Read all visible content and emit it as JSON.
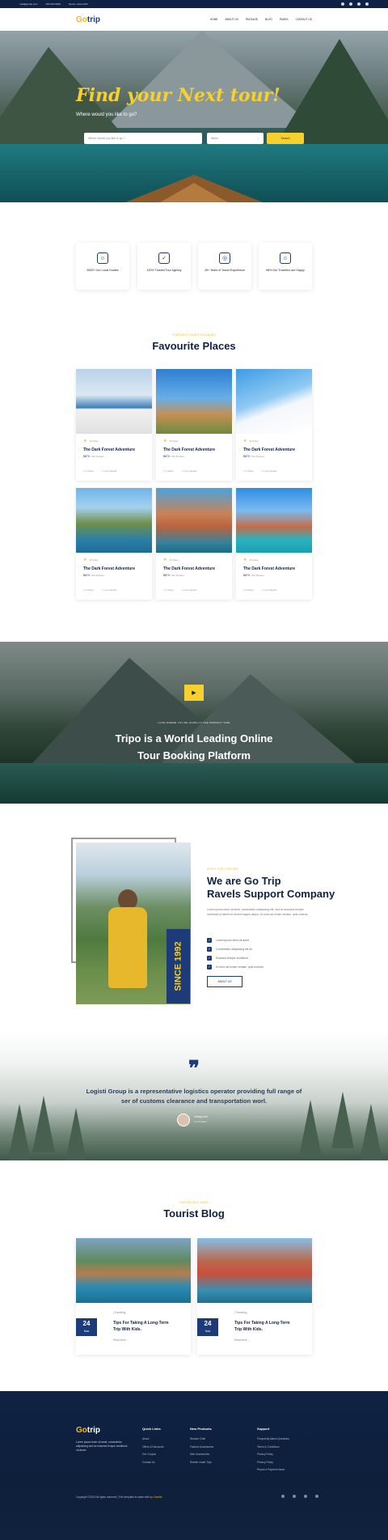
{
  "topbar": {
    "email": "mail@gotrip.com",
    "phone": "000 000 0000",
    "address": "Sector, street 000",
    "social_icons": [
      "twitter-icon",
      "youtube-icon",
      "facebook-icon",
      "instagram-icon"
    ]
  },
  "nav": {
    "logo_go": "Go",
    "logo_trip": "trip",
    "items": [
      "HOME",
      "ABOUT US",
      "PACKAGE",
      "BLOG",
      "PAGES",
      "CONTACT US"
    ]
  },
  "hero": {
    "title": "Find your Next tour!",
    "subtitle": "Where would you like to go?",
    "search_placeholder": "Where Would you like to go ?",
    "when_placeholder": "When",
    "search_button": "Search"
  },
  "features": [
    {
      "icon": "guide-icon",
      "label": "5000+ Our Local Guides"
    },
    {
      "icon": "trusted-icon",
      "label": "100% Trusted Tour Agency"
    },
    {
      "icon": "experience-icon",
      "label": "28+ Years of Travel Experience"
    },
    {
      "icon": "happy-icon",
      "label": "98% Our Travelers are Happy"
    }
  ],
  "places": {
    "kicker": "FEATURED TOURS PACKAGES",
    "title": "Favourite Places",
    "cards": [
      {
        "reviews": "32 Days",
        "title": "The Dark Forest Adventure",
        "price": "$870",
        "per": "/ Per Person",
        "days": "3 Days",
        "location": "Los Angeles"
      },
      {
        "reviews": "32 Days",
        "title": "The Dark Forest Adventure",
        "price": "$870",
        "per": "/ Per Person",
        "days": "3 Days",
        "location": "Los Angeles"
      },
      {
        "reviews": "32 Days",
        "title": "The Dark Forest Adventure",
        "price": "$870",
        "per": "/ Per Person",
        "days": "3 Days",
        "location": "Los Angeles"
      },
      {
        "reviews": "32 Days",
        "title": "The Dark Forest Adventure",
        "price": "$870",
        "per": "/ Per Person",
        "days": "3 Days",
        "location": "Los Angeles"
      },
      {
        "reviews": "32 Days",
        "title": "The Dark Forest Adventure",
        "price": "$870",
        "per": "/ Per Person",
        "days": "3 Days",
        "location": "Los Angeles"
      },
      {
        "reviews": "32 Days",
        "title": "The Dark Forest Adventure",
        "price": "$870",
        "per": "/ Per Person",
        "days": "3 Days",
        "location": "Los Angeles"
      }
    ]
  },
  "video": {
    "kicker": "LOVE WHERE YOU'RE GOING IN THE PERFECT TIME",
    "title_line1": "Tripo is a World Leading Online",
    "title_line2": "Tour Booking Platform"
  },
  "about": {
    "since": "SINCE 1992",
    "kicker": "APPLY FOR CONFIRM",
    "title_line1": "We are Go Trip",
    "title_line2": "Ravels Support Company",
    "text": "Lorem ipsum dolor sit amet, consectetur adipisicing elit, sed do eiusmod tempor incididunt ut labore et dolore magna aliqua. Ut enim ad minim veniam, quis nostrud.",
    "list": [
      "Lorem ipsum dolor sit amet",
      "Consectetur adipisicing elit do",
      "Eiusmod tempor incididunt",
      "Ut enim ad minim veniam, quis nostrud"
    ],
    "button": "ABOUT US"
  },
  "testimonial": {
    "text": "Logisti Group is a representative logistics operator providing full range of ser of customs clearance and transportation worl.",
    "name": "Jessya Inn",
    "role": "Co Founder"
  },
  "blog": {
    "kicker": "OUR RECENT NEWS",
    "title": "Tourist Blog",
    "posts": [
      {
        "day": "24",
        "month": "Now",
        "category": "Travelling",
        "title_line1": "Tips For Taking A Long-Term",
        "title_line2": "Trip With Kids.",
        "more": "Read More"
      },
      {
        "day": "24",
        "month": "Now",
        "category": "Travelling",
        "title_line1": "Tips For Taking A Long-Term",
        "title_line2": "Trip With Kids.",
        "more": "Read More"
      }
    ]
  },
  "footer": {
    "logo_go": "Go",
    "logo_trip": "trip",
    "description": "Lorem ipsum dolor sit amet, consectetur adipisicing sed do eiusmod tempor incididunt ut labore.",
    "columns": [
      {
        "title": "Quick Links",
        "items": [
          "About",
          "Offers & Discounts",
          "Get Coupon",
          "Contact Us"
        ]
      },
      {
        "title": "New Products",
        "items": [
          "Woman Cloth",
          "Fashion Accessories",
          "Man Accessories",
          "Rubber made Toys"
        ]
      },
      {
        "title": "Support",
        "items": [
          "Frequently Asked Questions",
          "Terms & Conditions",
          "Privacy Policy",
          "Privacy Policy",
          "Report a Payment Issue"
        ]
      }
    ],
    "copyright": "Copyright ©2023 All rights reserved | This template is made with",
    "brand": "by Colorlib",
    "social_icons": [
      "twitter-icon",
      "facebook-icon",
      "behance-icon",
      "globe-icon"
    ]
  },
  "colors": {
    "navy": "#0f2243",
    "brand_blue": "#1c3b78",
    "accent_yellow": "#f6d12e"
  }
}
